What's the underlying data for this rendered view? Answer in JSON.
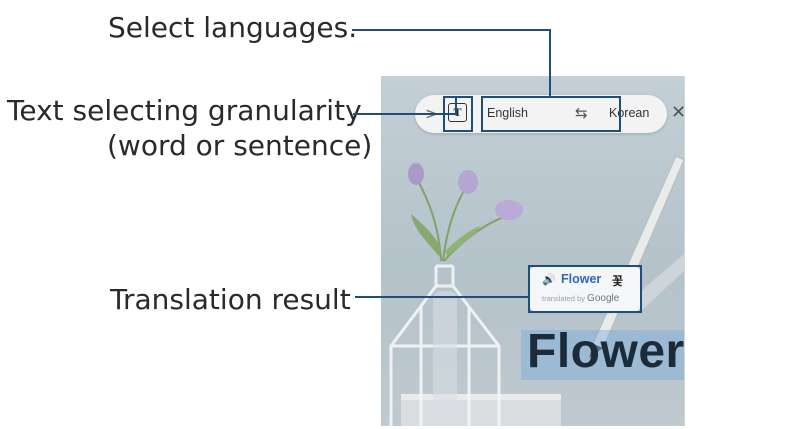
{
  "callouts": {
    "select_languages": "Select languages.",
    "granularity_line1": "Text selecting granularity",
    "granularity_line2": "(word or sentence)",
    "translation_result": "Translation result"
  },
  "toolbar": {
    "chevron": ">",
    "granularity_glyph": "T",
    "source_language": "English",
    "swap_glyph": "⇆",
    "target_language": "Korean",
    "close_glyph": "✕"
  },
  "popup": {
    "speaker_glyph": "🔊",
    "word": "Flower",
    "translation": "꽃",
    "credit_prefix": "translated by",
    "credit_brand": "Google"
  },
  "picture": {
    "word": "Flower"
  },
  "colors": {
    "callout_line": "#1f4f78",
    "frame": "#1f4f78",
    "popup_accent": "#2f66c4"
  },
  "icons": [
    "chevron-right-icon",
    "text-granularity-icon",
    "swap-icon",
    "close-icon",
    "speaker-icon",
    "s-pen-icon"
  ]
}
